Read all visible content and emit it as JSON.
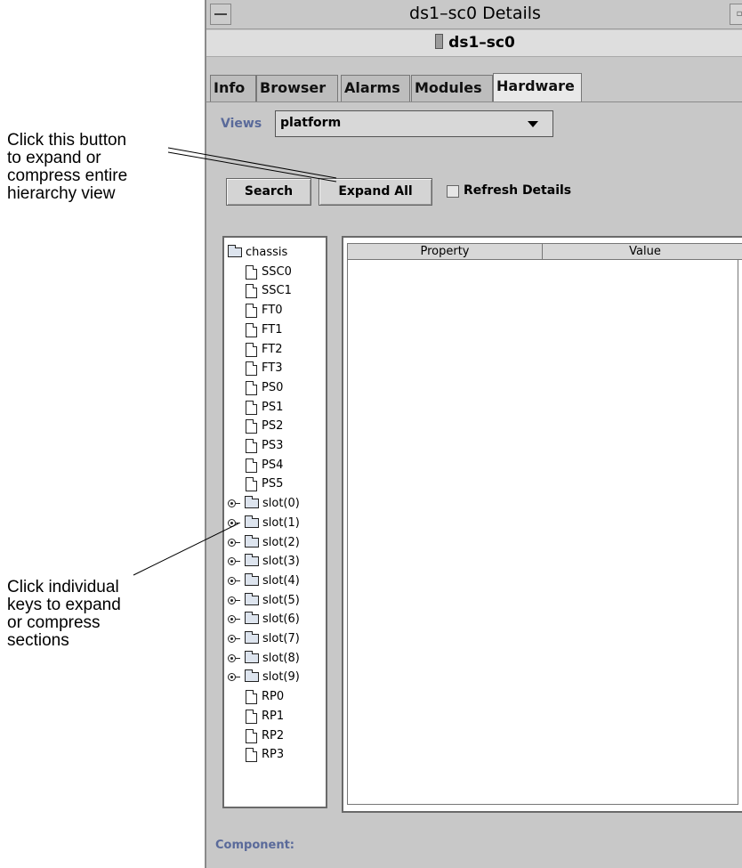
{
  "annotations": {
    "expand_all_note": "Click this button\nto expand or\ncompress entire\nhierarchy view",
    "keys_note": "Click individual\nkeys to expand\nor compress\nsections"
  },
  "window": {
    "title": "ds1–sc0 Details",
    "subtitle": "ds1–sc0"
  },
  "tabs": [
    "Info",
    "Browser",
    "Alarms",
    "Modules",
    "Hardware"
  ],
  "active_tab": "Hardware",
  "views": {
    "label": "Views",
    "value": "platform"
  },
  "buttons": {
    "search": "Search",
    "expand_all": "Expand All"
  },
  "refresh": {
    "label": "Refresh Details",
    "checked": false
  },
  "tree": [
    {
      "label": "chassis",
      "kind": "folder",
      "level": 0
    },
    {
      "label": "SSC0",
      "kind": "doc",
      "level": 1
    },
    {
      "label": "SSC1",
      "kind": "doc",
      "level": 1
    },
    {
      "label": "FT0",
      "kind": "doc",
      "level": 1
    },
    {
      "label": "FT1",
      "kind": "doc",
      "level": 1
    },
    {
      "label": "FT2",
      "kind": "doc",
      "level": 1
    },
    {
      "label": "FT3",
      "kind": "doc",
      "level": 1
    },
    {
      "label": "PS0",
      "kind": "doc",
      "level": 1
    },
    {
      "label": "PS1",
      "kind": "doc",
      "level": 1
    },
    {
      "label": "PS2",
      "kind": "doc",
      "level": 1
    },
    {
      "label": "PS3",
      "kind": "doc",
      "level": 1
    },
    {
      "label": "PS4",
      "kind": "doc",
      "level": 1
    },
    {
      "label": "PS5",
      "kind": "doc",
      "level": 1
    },
    {
      "label": "slot(0)",
      "kind": "keyfolder",
      "level": 1
    },
    {
      "label": "slot(1)",
      "kind": "keyfolder",
      "level": 1
    },
    {
      "label": "slot(2)",
      "kind": "keyfolder",
      "level": 1
    },
    {
      "label": "slot(3)",
      "kind": "keyfolder",
      "level": 1
    },
    {
      "label": "slot(4)",
      "kind": "keyfolder",
      "level": 1
    },
    {
      "label": "slot(5)",
      "kind": "keyfolder",
      "level": 1
    },
    {
      "label": "slot(6)",
      "kind": "keyfolder",
      "level": 1
    },
    {
      "label": "slot(7)",
      "kind": "keyfolder",
      "level": 1
    },
    {
      "label": "slot(8)",
      "kind": "keyfolder",
      "level": 1
    },
    {
      "label": "slot(9)",
      "kind": "keyfolder",
      "level": 1
    },
    {
      "label": "RP0",
      "kind": "doc",
      "level": 1
    },
    {
      "label": "RP1",
      "kind": "doc",
      "level": 1
    },
    {
      "label": "RP2",
      "kind": "doc",
      "level": 1
    },
    {
      "label": "RP3",
      "kind": "doc",
      "level": 1
    }
  ],
  "table": {
    "columns": [
      "Property",
      "Value"
    ],
    "rows": []
  },
  "component_label": "Component:",
  "icons": {
    "window_menu": "window-menu-icon",
    "minimize": "minimize-icon",
    "server": "server-icon",
    "dropdown": "chevron-down-icon"
  },
  "colors": {
    "window_bg": "#c8c8c8",
    "label_blue": "#5a6a9a"
  }
}
